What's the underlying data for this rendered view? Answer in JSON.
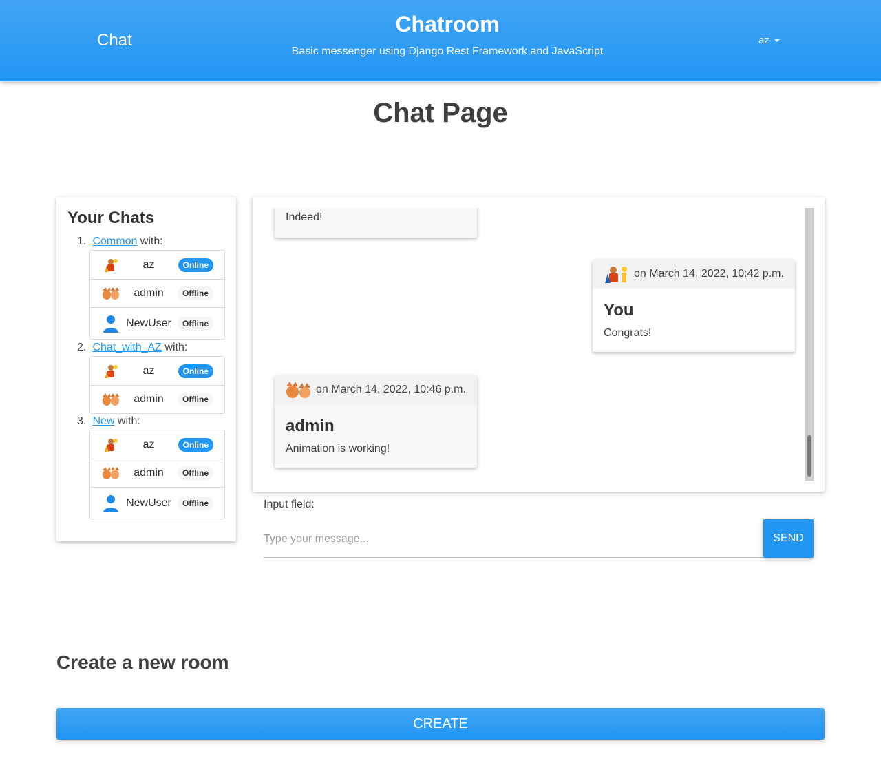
{
  "navbar": {
    "brand": "Chat",
    "title": "Chatroom",
    "subtitle": "Basic messenger using Django Rest Framework and JavaScript",
    "user": "az"
  },
  "page": {
    "title": "Chat Page"
  },
  "chats": {
    "title": "Your Chats",
    "with_label": "with:",
    "rooms": [
      {
        "number": "1.",
        "name": "Common",
        "members": [
          {
            "name": "az",
            "status": "Online",
            "avatar": "warrior-avatar"
          },
          {
            "name": "admin",
            "status": "Offline",
            "avatar": "foxes-avatar"
          },
          {
            "name": "NewUser",
            "status": "Offline",
            "avatar": "person-icon"
          }
        ]
      },
      {
        "number": "2.",
        "name": "Chat_with_AZ",
        "members": [
          {
            "name": "az",
            "status": "Online",
            "avatar": "warrior-avatar"
          },
          {
            "name": "admin",
            "status": "Offline",
            "avatar": "foxes-avatar"
          }
        ]
      },
      {
        "number": "3.",
        "name": "New",
        "members": [
          {
            "name": "az",
            "status": "Online",
            "avatar": "warrior-avatar"
          },
          {
            "name": "admin",
            "status": "Offline",
            "avatar": "foxes-avatar"
          },
          {
            "name": "NewUser",
            "status": "Offline",
            "avatar": "person-icon"
          }
        ]
      }
    ]
  },
  "messages": [
    {
      "text": "Indeed!",
      "side": "left",
      "partial": true
    },
    {
      "date": "on March 14, 2022, 10:42 p.m.",
      "author": "You",
      "text": "Congrats!",
      "side": "right",
      "avatar": "warrior-avatar"
    },
    {
      "date": "on March 14, 2022, 10:46 p.m.",
      "author": "admin",
      "text": "Animation is working!",
      "side": "left",
      "avatar": "foxes-avatar"
    }
  ],
  "input": {
    "label": "Input field:",
    "placeholder": "Type your message...",
    "value": ""
  },
  "send_label": "SEND",
  "create": {
    "title": "Create a new room",
    "button": "CREATE"
  },
  "colors": {
    "primary": "#2196f3",
    "primary_light": "#42a5f5",
    "text": "#424242"
  }
}
